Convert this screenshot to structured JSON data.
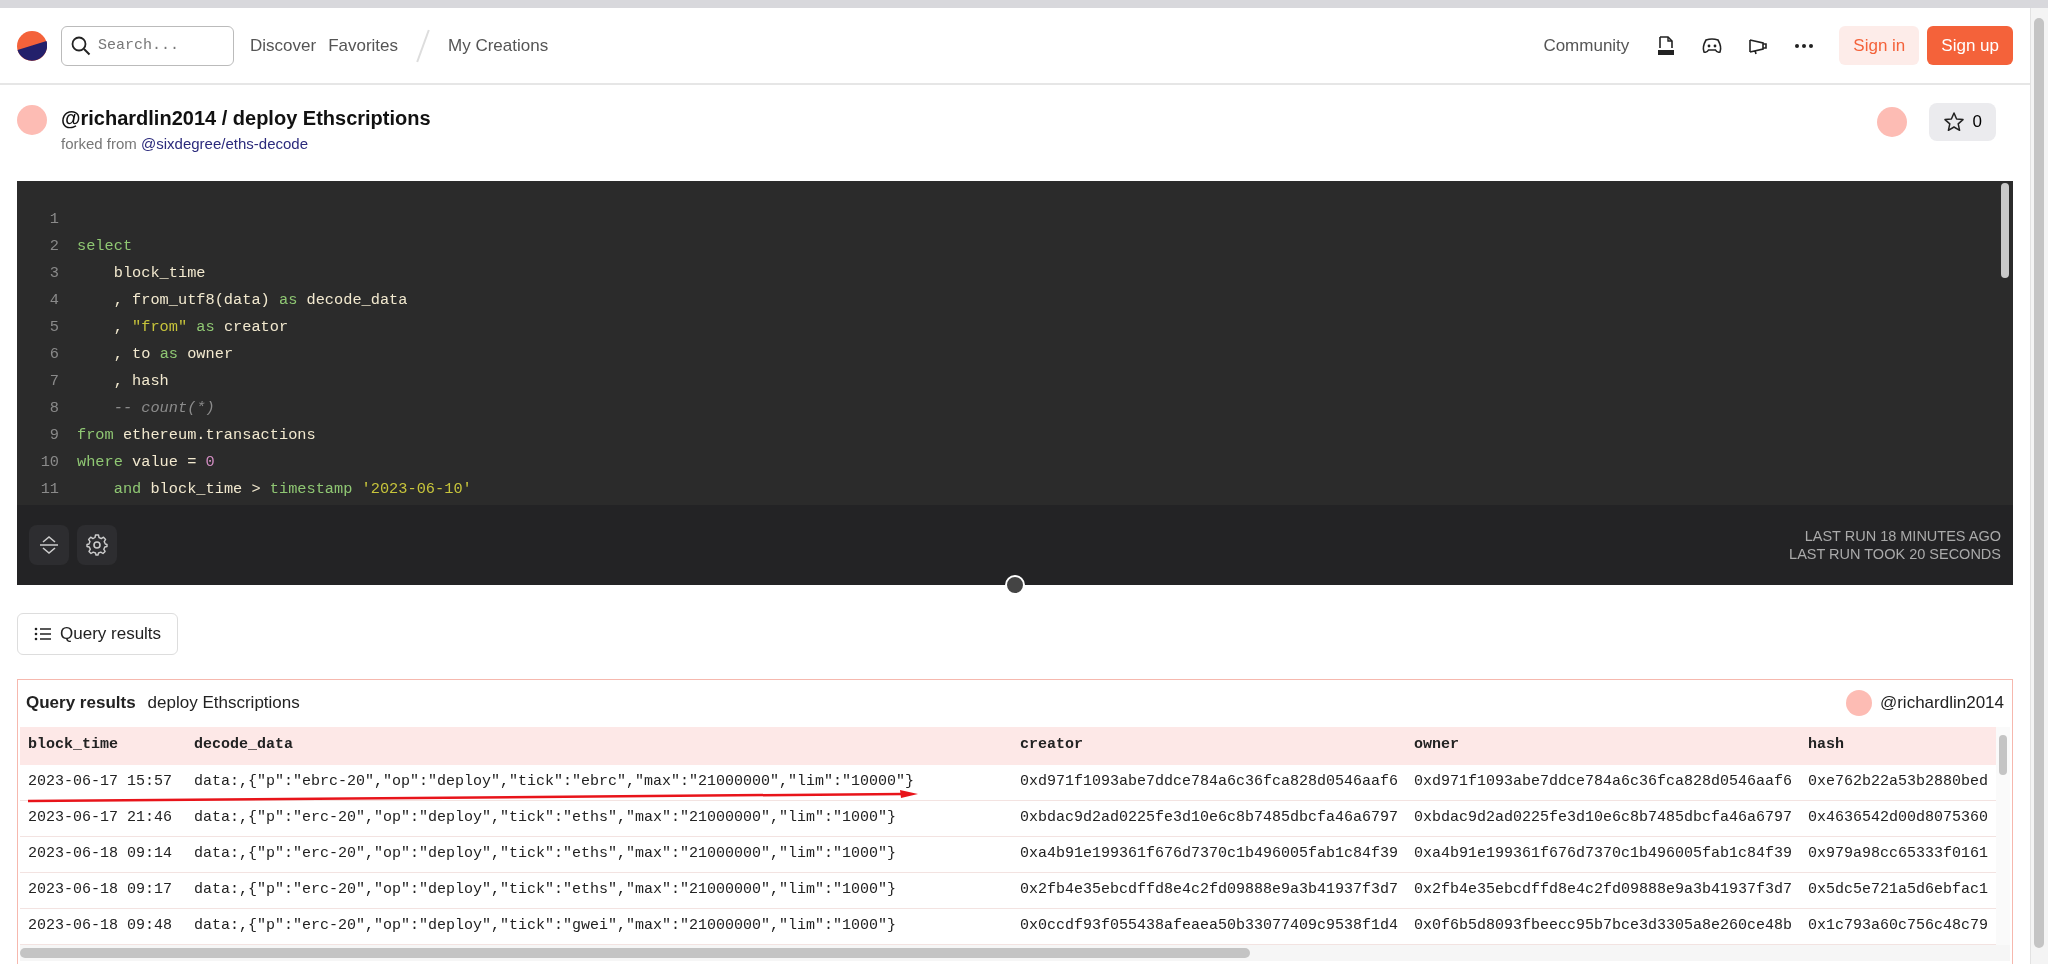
{
  "header": {
    "search": {
      "placeholder": "Search..."
    },
    "nav": [
      {
        "label": "Discover"
      },
      {
        "label": "Favorites"
      },
      {
        "label": "My Creations"
      }
    ],
    "community": "Community",
    "sign_in": "Sign in",
    "sign_up": "Sign up"
  },
  "query": {
    "owner": "@richardlin2014",
    "separator": " / ",
    "title": "deploy Ethscriptions",
    "forked_label": "forked from",
    "forked_link": "@sixdegree/eths-decode",
    "stars": "0"
  },
  "editor": {
    "lines": [
      {
        "number": "1"
      },
      {
        "number": "2",
        "tokens": [
          {
            "kind": "keyword",
            "text": "select"
          }
        ]
      },
      {
        "number": "3",
        "tokens": [
          {
            "kind": "plain",
            "text": "    block_time"
          }
        ]
      },
      {
        "number": "4",
        "tokens": [
          {
            "kind": "plain",
            "text": "    , from_utf8(data) "
          },
          {
            "kind": "keyword",
            "text": "as"
          },
          {
            "kind": "plain",
            "text": " decode_data"
          }
        ]
      },
      {
        "number": "5",
        "tokens": [
          {
            "kind": "plain",
            "text": "    , "
          },
          {
            "kind": "string",
            "text": "\"from\""
          },
          {
            "kind": "keyword",
            "text": " as"
          },
          {
            "kind": "plain",
            "text": " creator"
          }
        ]
      },
      {
        "number": "6",
        "tokens": [
          {
            "kind": "plain",
            "text": "    , to "
          },
          {
            "kind": "keyword",
            "text": "as"
          },
          {
            "kind": "plain",
            "text": " owner"
          }
        ]
      },
      {
        "number": "7",
        "tokens": [
          {
            "kind": "plain",
            "text": "    , hash"
          }
        ]
      },
      {
        "number": "8",
        "tokens": [
          {
            "kind": "comment",
            "text": "    -- count(*)"
          }
        ]
      },
      {
        "number": "9",
        "tokens": [
          {
            "kind": "keyword",
            "text": "from"
          },
          {
            "kind": "plain",
            "text": " ethereum.transactions"
          }
        ]
      },
      {
        "number": "10",
        "tokens": [
          {
            "kind": "keyword",
            "text": "where"
          },
          {
            "kind": "plain",
            "text": " value = "
          },
          {
            "kind": "number",
            "text": "0"
          }
        ]
      },
      {
        "number": "11",
        "tokens": [
          {
            "kind": "keyword",
            "text": "    and"
          },
          {
            "kind": "plain",
            "text": " block_time > "
          },
          {
            "kind": "keyword",
            "text": "timestamp"
          },
          {
            "kind": "string",
            "text": " '2023-06-10'"
          }
        ]
      }
    ],
    "last_run": "LAST RUN 18 MINUTES AGO",
    "run_time": "LAST RUN TOOK 20 SECONDS"
  },
  "results_tab": "Query results",
  "results": {
    "label": "Query results",
    "title": "deploy Ethscriptions",
    "author": "@richardlin2014",
    "columns": [
      "block_time",
      "decode_data",
      "creator",
      "owner",
      "hash"
    ],
    "rows": [
      {
        "arrow_marked": true,
        "cells": [
          "2023-06-17 15:57",
          "data:,{\"p\":\"ebrc-20\",\"op\":\"deploy\",\"tick\":\"ebrc\",\"max\":\"21000000\",\"lim\":\"10000\"}",
          "0xd971f1093abe7ddce784a6c36fca828d0546aaf6",
          "0xd971f1093abe7ddce784a6c36fca828d0546aaf6",
          "0xe762b22a53b2880bed"
        ]
      },
      {
        "arrow_marked": false,
        "cells": [
          "2023-06-17 21:46",
          "data:,{\"p\":\"erc-20\",\"op\":\"deploy\",\"tick\":\"eths\",\"max\":\"21000000\",\"lim\":\"1000\"}",
          "0xbdac9d2ad0225fe3d10e6c8b7485dbcfa46a6797",
          "0xbdac9d2ad0225fe3d10e6c8b7485dbcfa46a6797",
          "0x4636542d00d8075360"
        ]
      },
      {
        "arrow_marked": false,
        "cells": [
          "2023-06-18 09:14",
          "data:,{\"p\":\"erc-20\",\"op\":\"deploy\",\"tick\":\"eths\",\"max\":\"21000000\",\"lim\":\"1000\"}",
          "0xa4b91e199361f676d7370c1b496005fab1c84f39",
          "0xa4b91e199361f676d7370c1b496005fab1c84f39",
          "0x979a98cc65333f0161"
        ]
      },
      {
        "arrow_marked": false,
        "cells": [
          "2023-06-18 09:17",
          "data:,{\"p\":\"erc-20\",\"op\":\"deploy\",\"tick\":\"eths\",\"max\":\"21000000\",\"lim\":\"1000\"}",
          "0x2fb4e35ebcdffd8e4c2fd09888e9a3b41937f3d7",
          "0x2fb4e35ebcdffd8e4c2fd09888e9a3b41937f3d7",
          "0x5dc5e721a5d6ebfac1"
        ]
      },
      {
        "arrow_marked": false,
        "cells": [
          "2023-06-18 09:48",
          "data:,{\"p\":\"erc-20\",\"op\":\"deploy\",\"tick\":\"gwei\",\"max\":\"21000000\",\"lim\":\"1000\"}",
          "0x0ccdf93f055438afeaea50b33077409c9538f1d4",
          "0x0f6b5d8093fbeecc95b7bce3d3305a8e260ce48b",
          "0x1c793a60c756c48c79"
        ]
      }
    ]
  }
}
